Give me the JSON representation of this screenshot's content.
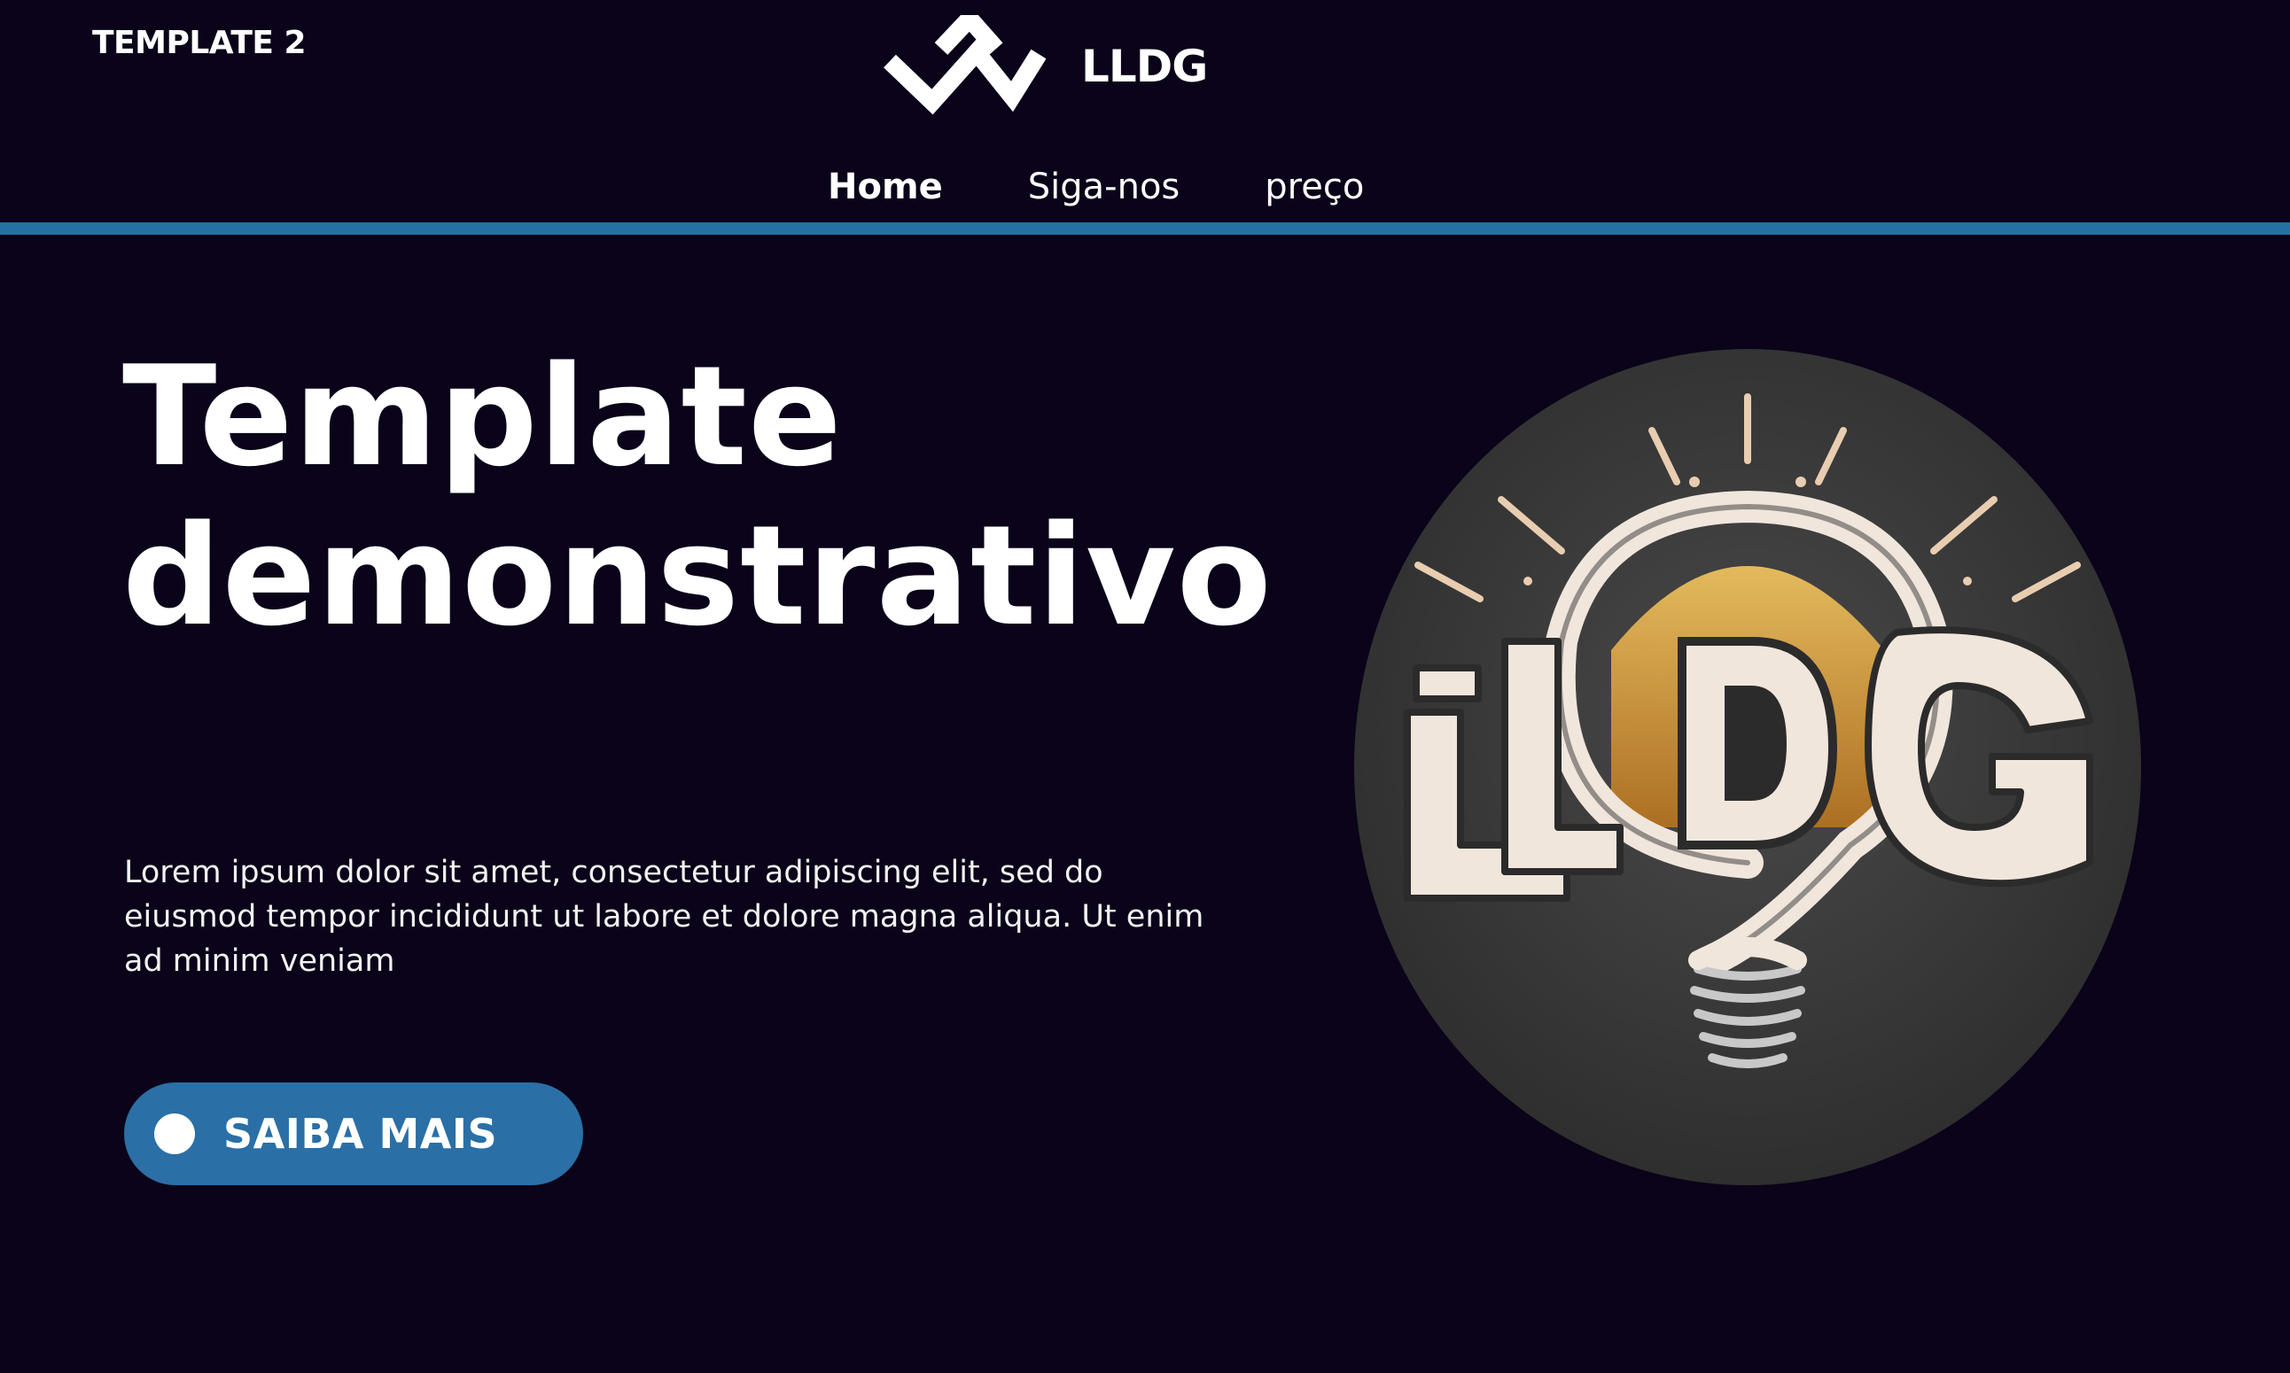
{
  "page": {
    "template_label": "TEMPLATE 2"
  },
  "header": {
    "brand_name": "LLDG",
    "logo_icon": "zigzag-w-logo-icon"
  },
  "nav": {
    "items": [
      {
        "label": "Home",
        "active": true
      },
      {
        "label": "Siga-nos",
        "active": false
      },
      {
        "label": "preço",
        "active": false
      }
    ]
  },
  "hero": {
    "title_line1": "Template",
    "title_line2": "demonstrativo",
    "body": "Lorem ipsum dolor sit amet, consectetur adipiscing elit, sed do eiusmod tempor incididunt ut labore et dolore magna aliqua. Ut enim ad minim veniam",
    "cta_label": "SAIBA MAIS",
    "image_icon": "lightbulb-logo-image"
  },
  "colors": {
    "background": "#0a0319",
    "accent": "#2471a3",
    "button": "#2a6fa6",
    "text": "#ffffff"
  }
}
